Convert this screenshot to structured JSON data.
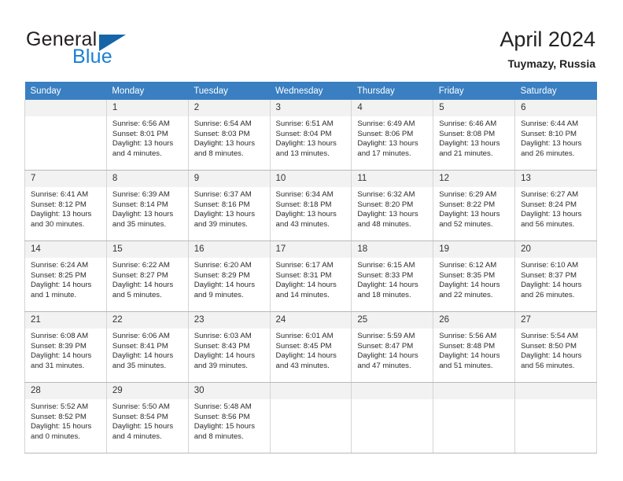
{
  "brand": {
    "word1": "General",
    "word2": "Blue",
    "flag_icon": "blue-triangle-flag-icon",
    "colors": {
      "general": "#231f20",
      "blue": "#1a7fd4",
      "flag": "#1565a8"
    }
  },
  "header": {
    "title": "April 2024",
    "subtitle": "Tuymazy, Russia"
  },
  "theme": {
    "header_bar": "#3a7fc1",
    "daynum_bg": "#f2f2f2",
    "grid_line": "#d4d4d4"
  },
  "weekdays": [
    "Sunday",
    "Monday",
    "Tuesday",
    "Wednesday",
    "Thursday",
    "Friday",
    "Saturday"
  ],
  "weeks": [
    [
      {
        "day": "",
        "empty": true
      },
      {
        "day": "1",
        "sunrise": "Sunrise: 6:56 AM",
        "sunset": "Sunset: 8:01 PM",
        "daylight1": "Daylight: 13 hours",
        "daylight2": "and 4 minutes."
      },
      {
        "day": "2",
        "sunrise": "Sunrise: 6:54 AM",
        "sunset": "Sunset: 8:03 PM",
        "daylight1": "Daylight: 13 hours",
        "daylight2": "and 8 minutes."
      },
      {
        "day": "3",
        "sunrise": "Sunrise: 6:51 AM",
        "sunset": "Sunset: 8:04 PM",
        "daylight1": "Daylight: 13 hours",
        "daylight2": "and 13 minutes."
      },
      {
        "day": "4",
        "sunrise": "Sunrise: 6:49 AM",
        "sunset": "Sunset: 8:06 PM",
        "daylight1": "Daylight: 13 hours",
        "daylight2": "and 17 minutes."
      },
      {
        "day": "5",
        "sunrise": "Sunrise: 6:46 AM",
        "sunset": "Sunset: 8:08 PM",
        "daylight1": "Daylight: 13 hours",
        "daylight2": "and 21 minutes."
      },
      {
        "day": "6",
        "sunrise": "Sunrise: 6:44 AM",
        "sunset": "Sunset: 8:10 PM",
        "daylight1": "Daylight: 13 hours",
        "daylight2": "and 26 minutes."
      }
    ],
    [
      {
        "day": "7",
        "sunrise": "Sunrise: 6:41 AM",
        "sunset": "Sunset: 8:12 PM",
        "daylight1": "Daylight: 13 hours",
        "daylight2": "and 30 minutes."
      },
      {
        "day": "8",
        "sunrise": "Sunrise: 6:39 AM",
        "sunset": "Sunset: 8:14 PM",
        "daylight1": "Daylight: 13 hours",
        "daylight2": "and 35 minutes."
      },
      {
        "day": "9",
        "sunrise": "Sunrise: 6:37 AM",
        "sunset": "Sunset: 8:16 PM",
        "daylight1": "Daylight: 13 hours",
        "daylight2": "and 39 minutes."
      },
      {
        "day": "10",
        "sunrise": "Sunrise: 6:34 AM",
        "sunset": "Sunset: 8:18 PM",
        "daylight1": "Daylight: 13 hours",
        "daylight2": "and 43 minutes."
      },
      {
        "day": "11",
        "sunrise": "Sunrise: 6:32 AM",
        "sunset": "Sunset: 8:20 PM",
        "daylight1": "Daylight: 13 hours",
        "daylight2": "and 48 minutes."
      },
      {
        "day": "12",
        "sunrise": "Sunrise: 6:29 AM",
        "sunset": "Sunset: 8:22 PM",
        "daylight1": "Daylight: 13 hours",
        "daylight2": "and 52 minutes."
      },
      {
        "day": "13",
        "sunrise": "Sunrise: 6:27 AM",
        "sunset": "Sunset: 8:24 PM",
        "daylight1": "Daylight: 13 hours",
        "daylight2": "and 56 minutes."
      }
    ],
    [
      {
        "day": "14",
        "sunrise": "Sunrise: 6:24 AM",
        "sunset": "Sunset: 8:25 PM",
        "daylight1": "Daylight: 14 hours",
        "daylight2": "and 1 minute."
      },
      {
        "day": "15",
        "sunrise": "Sunrise: 6:22 AM",
        "sunset": "Sunset: 8:27 PM",
        "daylight1": "Daylight: 14 hours",
        "daylight2": "and 5 minutes."
      },
      {
        "day": "16",
        "sunrise": "Sunrise: 6:20 AM",
        "sunset": "Sunset: 8:29 PM",
        "daylight1": "Daylight: 14 hours",
        "daylight2": "and 9 minutes."
      },
      {
        "day": "17",
        "sunrise": "Sunrise: 6:17 AM",
        "sunset": "Sunset: 8:31 PM",
        "daylight1": "Daylight: 14 hours",
        "daylight2": "and 14 minutes."
      },
      {
        "day": "18",
        "sunrise": "Sunrise: 6:15 AM",
        "sunset": "Sunset: 8:33 PM",
        "daylight1": "Daylight: 14 hours",
        "daylight2": "and 18 minutes."
      },
      {
        "day": "19",
        "sunrise": "Sunrise: 6:12 AM",
        "sunset": "Sunset: 8:35 PM",
        "daylight1": "Daylight: 14 hours",
        "daylight2": "and 22 minutes."
      },
      {
        "day": "20",
        "sunrise": "Sunrise: 6:10 AM",
        "sunset": "Sunset: 8:37 PM",
        "daylight1": "Daylight: 14 hours",
        "daylight2": "and 26 minutes."
      }
    ],
    [
      {
        "day": "21",
        "sunrise": "Sunrise: 6:08 AM",
        "sunset": "Sunset: 8:39 PM",
        "daylight1": "Daylight: 14 hours",
        "daylight2": "and 31 minutes."
      },
      {
        "day": "22",
        "sunrise": "Sunrise: 6:06 AM",
        "sunset": "Sunset: 8:41 PM",
        "daylight1": "Daylight: 14 hours",
        "daylight2": "and 35 minutes."
      },
      {
        "day": "23",
        "sunrise": "Sunrise: 6:03 AM",
        "sunset": "Sunset: 8:43 PM",
        "daylight1": "Daylight: 14 hours",
        "daylight2": "and 39 minutes."
      },
      {
        "day": "24",
        "sunrise": "Sunrise: 6:01 AM",
        "sunset": "Sunset: 8:45 PM",
        "daylight1": "Daylight: 14 hours",
        "daylight2": "and 43 minutes."
      },
      {
        "day": "25",
        "sunrise": "Sunrise: 5:59 AM",
        "sunset": "Sunset: 8:47 PM",
        "daylight1": "Daylight: 14 hours",
        "daylight2": "and 47 minutes."
      },
      {
        "day": "26",
        "sunrise": "Sunrise: 5:56 AM",
        "sunset": "Sunset: 8:48 PM",
        "daylight1": "Daylight: 14 hours",
        "daylight2": "and 51 minutes."
      },
      {
        "day": "27",
        "sunrise": "Sunrise: 5:54 AM",
        "sunset": "Sunset: 8:50 PM",
        "daylight1": "Daylight: 14 hours",
        "daylight2": "and 56 minutes."
      }
    ],
    [
      {
        "day": "28",
        "sunrise": "Sunrise: 5:52 AM",
        "sunset": "Sunset: 8:52 PM",
        "daylight1": "Daylight: 15 hours",
        "daylight2": "and 0 minutes."
      },
      {
        "day": "29",
        "sunrise": "Sunrise: 5:50 AM",
        "sunset": "Sunset: 8:54 PM",
        "daylight1": "Daylight: 15 hours",
        "daylight2": "and 4 minutes."
      },
      {
        "day": "30",
        "sunrise": "Sunrise: 5:48 AM",
        "sunset": "Sunset: 8:56 PM",
        "daylight1": "Daylight: 15 hours",
        "daylight2": "and 8 minutes."
      },
      {
        "day": "",
        "empty": true
      },
      {
        "day": "",
        "empty": true
      },
      {
        "day": "",
        "empty": true
      },
      {
        "day": "",
        "empty": true
      }
    ]
  ]
}
